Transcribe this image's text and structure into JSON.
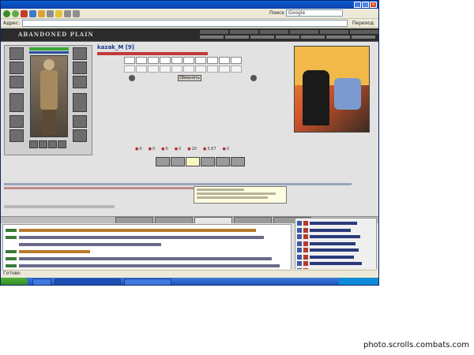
{
  "browser": {
    "search_label": "Поиск",
    "search_placeholder": "Google",
    "address_label": "Адрес:",
    "go_label": "Переход",
    "status_text": "Готово"
  },
  "game": {
    "logo": "ABANDONED PLAIN",
    "opponent_name": "kazak_M [9]",
    "attack_button": "Обменять",
    "stat_values": [
      "0",
      "0",
      "0",
      "0",
      "20",
      "3.67",
      "0"
    ]
  },
  "watermark": "photo.scrolls.combats.com"
}
